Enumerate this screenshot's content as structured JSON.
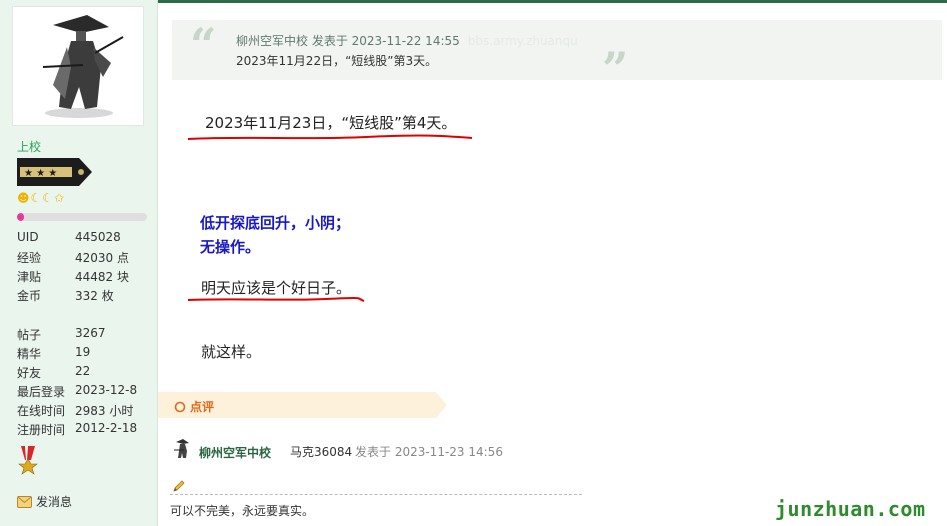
{
  "user": {
    "rank": "上校",
    "level_stars": [
      "☻",
      "☾",
      "☾",
      "✩"
    ],
    "progress_fraction": 0.05,
    "stats_a": [
      {
        "k": "UID",
        "v": "445028"
      },
      {
        "k": "经验",
        "v": "42030 点"
      },
      {
        "k": "津贴",
        "v": "44482 块"
      },
      {
        "k": "金币",
        "v": "332 枚"
      }
    ],
    "stats_b": [
      {
        "k": "帖子",
        "v": "3267"
      },
      {
        "k": "精华",
        "v": "19"
      },
      {
        "k": "好友",
        "v": "22"
      },
      {
        "k": "最后登录",
        "v": "2023-12-8"
      },
      {
        "k": "在线时间",
        "v": "2983 小时"
      },
      {
        "k": "注册时间",
        "v": "2012-2-18"
      }
    ],
    "send_message": "发消息"
  },
  "quote": {
    "open_mark": "“",
    "close_mark": "”",
    "author_line": "柳州空军中校 发表于 2023-11-22 14:55",
    "ghost_text": "bbs.army.zhuanqu",
    "text": "2023年11月22日，“短线股”第3天。"
  },
  "post": {
    "line1": "2023年11月23日，“短线股”第4天。",
    "blue1": "低开探底回升，小阴；",
    "blue2": "无操作。",
    "line3": "明天应该是个好日子。",
    "line4": "就这样。"
  },
  "dianping": {
    "label": "点评"
  },
  "comment": {
    "author": "柳州空军中校",
    "text": "马克36084",
    "meta": "发表于 2023-11-23 14:56"
  },
  "signature": "可以不完美，永远要真实。",
  "watermark": "junzhuan.com",
  "colors": {
    "sidebar_bg": "#eaf5ed",
    "rank_green": "#25a35a",
    "blue_text": "#1818c8",
    "underline_red": "#e00000",
    "dianping_orange": "#e06a1b",
    "watermark_green": "#2e8b2e"
  }
}
